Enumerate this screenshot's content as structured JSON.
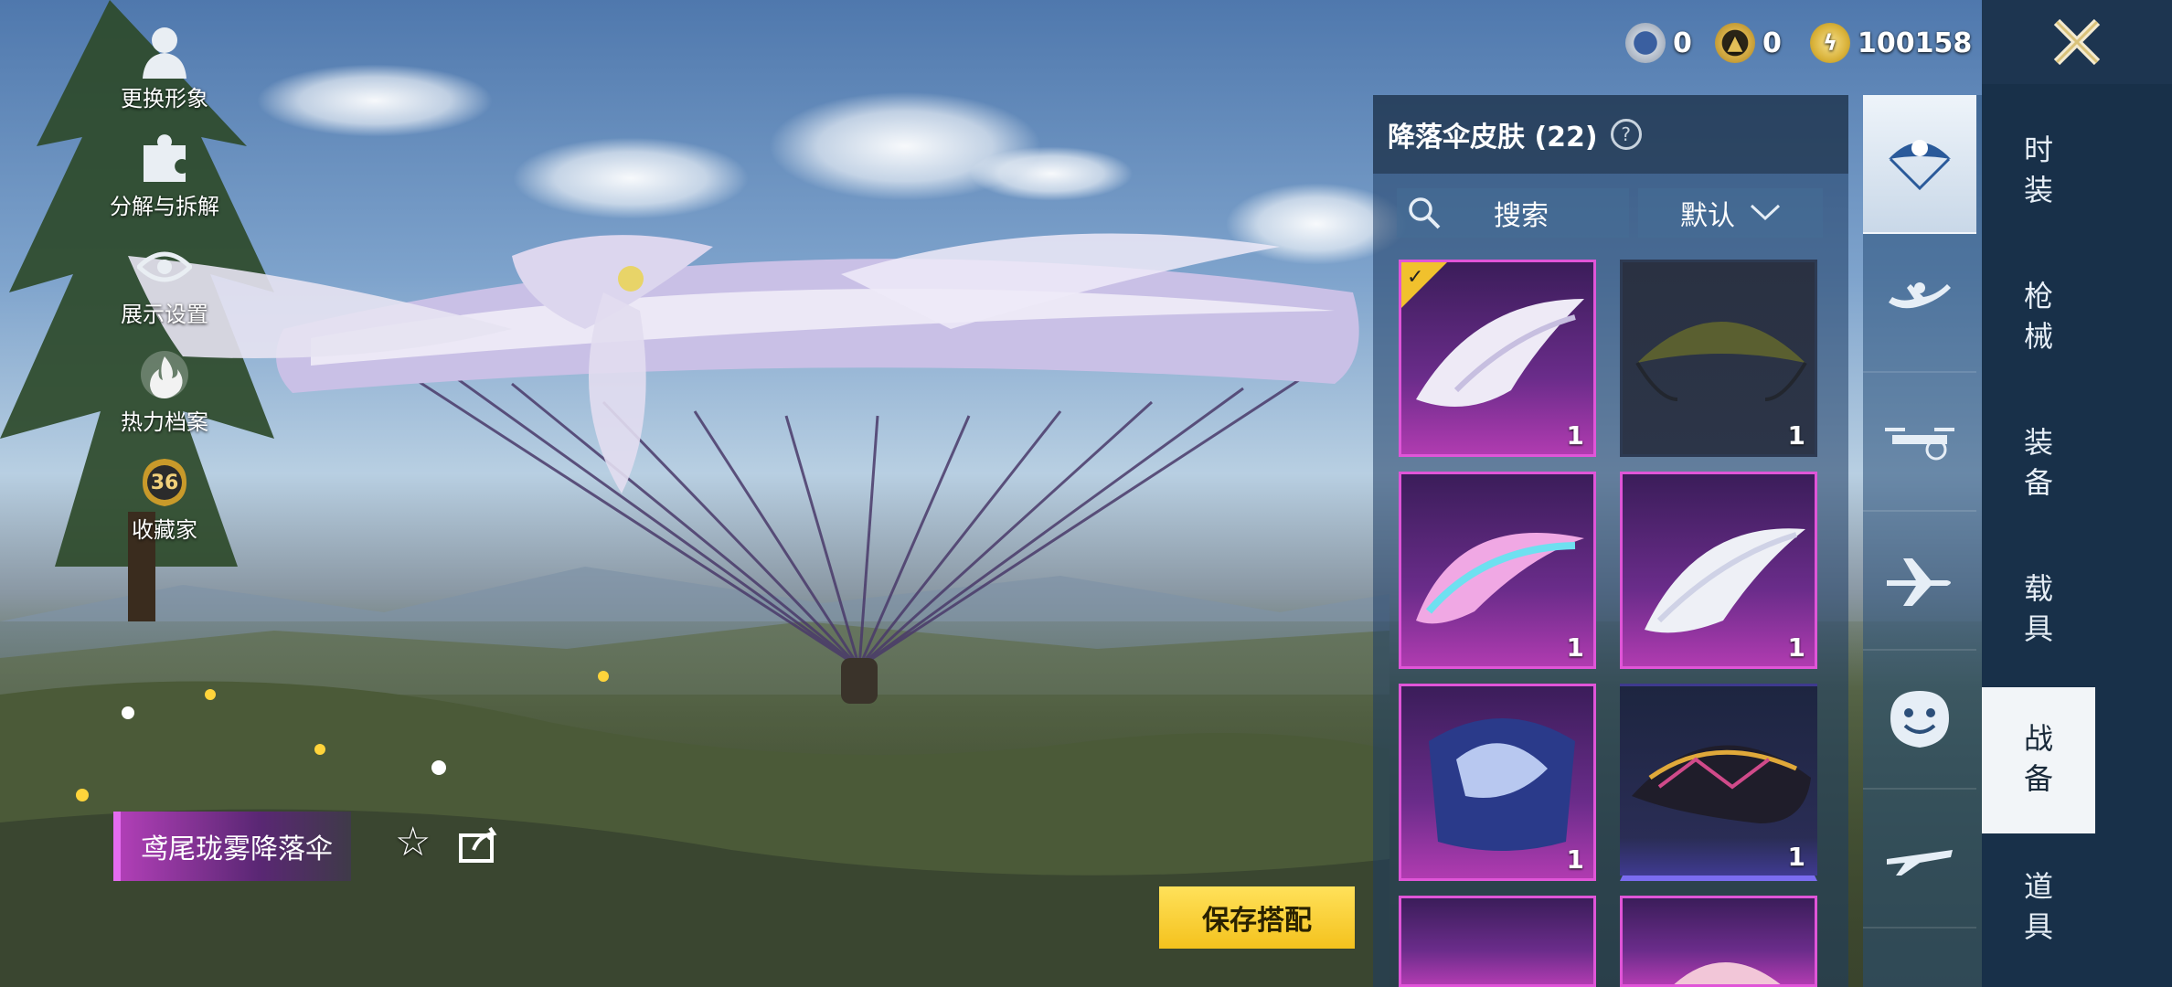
{
  "left_menu": [
    {
      "label": "更换形象",
      "icon": "avatar-icon"
    },
    {
      "label": "分解与拆解",
      "icon": "puzzle-icon"
    },
    {
      "label": "展示设置",
      "icon": "eye-icon"
    },
    {
      "label": "热力档案",
      "icon": "flame-icon"
    },
    {
      "label": "收藏家",
      "icon": "collector-badge-icon",
      "badge": "36"
    }
  ],
  "currency": [
    {
      "icon": "uc-coin-icon",
      "value": "0"
    },
    {
      "icon": "ag-coin-icon",
      "value": "0"
    },
    {
      "icon": "bp-coin-icon",
      "value": "100158"
    }
  ],
  "panel": {
    "title": "降落伞皮肤 (22)",
    "search_label": "搜索",
    "sort_label": "默认"
  },
  "items": [
    {
      "qty": "1",
      "style": "pink",
      "equipped": true
    },
    {
      "qty": "1",
      "style": "dark",
      "equipped": false
    },
    {
      "qty": "1",
      "style": "pink",
      "equipped": false
    },
    {
      "qty": "1",
      "style": "pink",
      "equipped": false
    },
    {
      "qty": "1",
      "style": "pink",
      "equipped": false
    },
    {
      "qty": "1",
      "style": "purple",
      "equipped": false
    }
  ],
  "categories": [
    "parachute-icon",
    "skydiver-icon",
    "drone-icon",
    "airplane-icon",
    "emote-icon",
    "glider-icon"
  ],
  "right_nav": [
    {
      "label": "时装",
      "active": false
    },
    {
      "label": "枪械",
      "active": false
    },
    {
      "label": "装备",
      "active": false
    },
    {
      "label": "载具",
      "active": false
    },
    {
      "label": "战备",
      "active": true
    },
    {
      "label": "道具",
      "active": false
    }
  ],
  "selected_name": "鸢尾珑雾降落伞",
  "save_button": "保存搭配",
  "colors": {
    "accent": "#f4c21d",
    "rarity_pink": "#e055d8",
    "nav_bg": "#183049"
  }
}
